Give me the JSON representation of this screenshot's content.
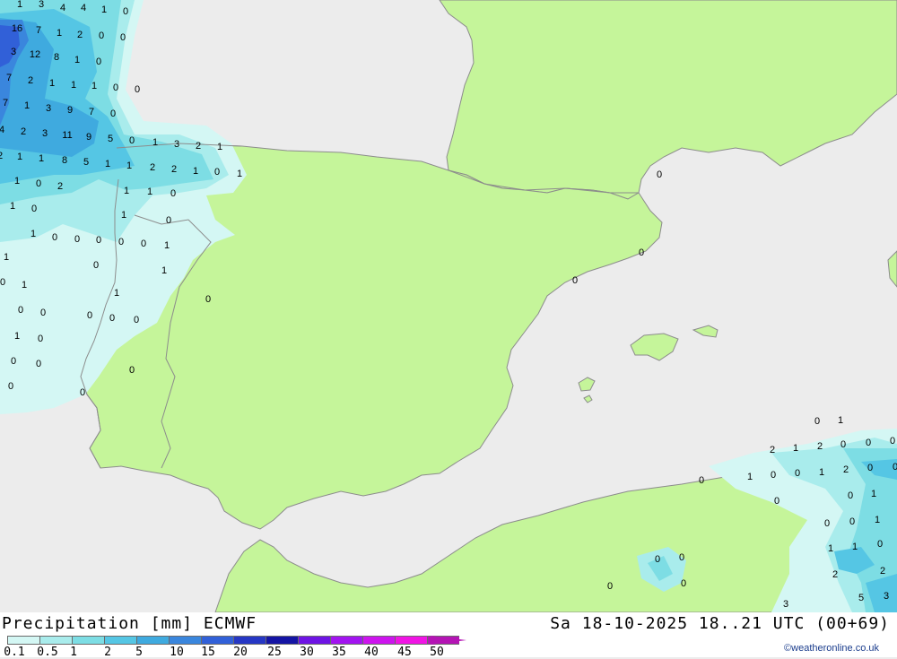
{
  "footer": {
    "title_left": "Precipitation [mm] ECMWF",
    "title_right": "Sa 18-10-2025 18..21 UTC (00+69)",
    "credit": "©weatheronline.co.uk"
  },
  "legend": [
    {
      "label": "0.1",
      "color": "#d4f7f4"
    },
    {
      "label": "0.5",
      "color": "#a9ecec"
    },
    {
      "label": "1",
      "color": "#7ddde4"
    },
    {
      "label": "2",
      "color": "#55c6e4"
    },
    {
      "label": "5",
      "color": "#3faadf"
    },
    {
      "label": "10",
      "color": "#3a86dd"
    },
    {
      "label": "15",
      "color": "#3160d8"
    },
    {
      "label": "20",
      "color": "#2637c4"
    },
    {
      "label": "25",
      "color": "#1414a4"
    },
    {
      "label": "30",
      "color": "#6e14e4"
    },
    {
      "label": "35",
      "color": "#a214f0"
    },
    {
      "label": "40",
      "color": "#cd14ee"
    },
    {
      "label": "45",
      "color": "#f014e4"
    },
    {
      "label": "50",
      "color": "#b414b4"
    }
  ],
  "colors": {
    "land": "#c5f59a",
    "sea": "#ececec",
    "coastline": "#8c8c8c"
  },
  "map_values": [
    {
      "text": "1"
    },
    {
      "text": "3"
    },
    {
      "text": "4"
    },
    {
      "text": "4"
    },
    {
      "text": "1"
    },
    {
      "text": "0"
    },
    {
      "text": "16"
    },
    {
      "text": "7"
    },
    {
      "text": "1"
    },
    {
      "text": "2"
    },
    {
      "text": "0"
    },
    {
      "text": "0"
    },
    {
      "text": "3"
    },
    {
      "text": "12"
    },
    {
      "text": "8"
    },
    {
      "text": "1"
    },
    {
      "text": "0"
    },
    {
      "text": "7"
    },
    {
      "text": "2"
    },
    {
      "text": "1"
    },
    {
      "text": "1"
    },
    {
      "text": "1"
    },
    {
      "text": "0"
    },
    {
      "text": "0"
    },
    {
      "text": "7"
    },
    {
      "text": "1"
    },
    {
      "text": "3"
    },
    {
      "text": "9"
    },
    {
      "text": "7"
    },
    {
      "text": "0"
    },
    {
      "text": "4"
    },
    {
      "text": "2"
    },
    {
      "text": "3"
    },
    {
      "text": "11"
    },
    {
      "text": "9"
    },
    {
      "text": "5"
    },
    {
      "text": "0"
    },
    {
      "text": "1"
    },
    {
      "text": "3"
    },
    {
      "text": "2"
    },
    {
      "text": "1"
    },
    {
      "text": "2"
    },
    {
      "text": "1"
    },
    {
      "text": "1"
    },
    {
      "text": "8"
    },
    {
      "text": "5"
    },
    {
      "text": "1"
    },
    {
      "text": "1"
    },
    {
      "text": "2"
    },
    {
      "text": "2"
    },
    {
      "text": "1"
    },
    {
      "text": "0"
    },
    {
      "text": "1"
    },
    {
      "text": "1"
    },
    {
      "text": "0"
    },
    {
      "text": "2"
    },
    {
      "text": "1"
    },
    {
      "text": "1"
    },
    {
      "text": "0"
    },
    {
      "text": "1"
    },
    {
      "text": "0"
    },
    {
      "text": "1"
    },
    {
      "text": "0"
    },
    {
      "text": "1"
    },
    {
      "text": "0"
    },
    {
      "text": "0"
    },
    {
      "text": "0"
    },
    {
      "text": "0"
    },
    {
      "text": "0"
    },
    {
      "text": "1"
    },
    {
      "text": "1"
    },
    {
      "text": "0"
    },
    {
      "text": "1"
    },
    {
      "text": "0"
    },
    {
      "text": "1"
    },
    {
      "text": "1"
    },
    {
      "text": "0"
    },
    {
      "text": "0"
    },
    {
      "text": "0"
    },
    {
      "text": "0"
    },
    {
      "text": "0"
    },
    {
      "text": "0"
    },
    {
      "text": "1"
    },
    {
      "text": "0"
    },
    {
      "text": "0"
    },
    {
      "text": "0"
    },
    {
      "text": "0"
    },
    {
      "text": "0"
    },
    {
      "text": "0"
    },
    {
      "text": "0"
    },
    {
      "text": "0"
    },
    {
      "text": "0"
    },
    {
      "text": "0"
    },
    {
      "text": "0"
    },
    {
      "text": "1"
    },
    {
      "text": "2"
    },
    {
      "text": "1"
    },
    {
      "text": "2"
    },
    {
      "text": "0"
    },
    {
      "text": "0"
    },
    {
      "text": "0"
    },
    {
      "text": "1"
    },
    {
      "text": "0"
    },
    {
      "text": "0"
    },
    {
      "text": "1"
    },
    {
      "text": "2"
    },
    {
      "text": "0"
    },
    {
      "text": "0"
    },
    {
      "text": "0"
    },
    {
      "text": "1"
    },
    {
      "text": "0"
    },
    {
      "text": "0"
    },
    {
      "text": "0"
    },
    {
      "text": "1"
    },
    {
      "text": "1"
    },
    {
      "text": "1"
    },
    {
      "text": "0"
    },
    {
      "text": "2"
    },
    {
      "text": "2"
    },
    {
      "text": "0"
    },
    {
      "text": "0"
    },
    {
      "text": "0"
    },
    {
      "text": "0"
    },
    {
      "text": "5"
    },
    {
      "text": "3"
    },
    {
      "text": "3"
    }
  ]
}
